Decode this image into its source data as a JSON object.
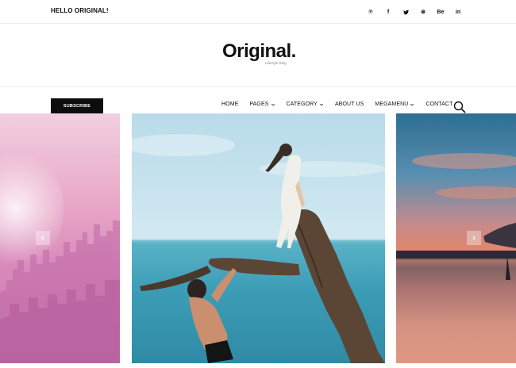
{
  "topbar": {
    "greeting": "HELLO ORIGINAL!",
    "socials": [
      {
        "icon": "pinterest-icon",
        "glyph": "℗"
      },
      {
        "icon": "facebook-icon",
        "glyph": "f"
      },
      {
        "icon": "twitter-icon",
        "glyph": "t"
      },
      {
        "icon": "dribbble-icon",
        "glyph": "⊛"
      },
      {
        "icon": "behance-icon",
        "glyph": "Be"
      },
      {
        "icon": "linkedin-icon",
        "glyph": "in"
      }
    ]
  },
  "brand": {
    "logo": "Original.",
    "tagline": "Lifestyle Blog"
  },
  "nav": {
    "subscribe_label": "SUBSCRIBE",
    "items": [
      {
        "label": "HOME",
        "dropdown": false
      },
      {
        "label": "PAGES",
        "dropdown": true
      },
      {
        "label": "CATEGORY",
        "dropdown": true
      },
      {
        "label": "ABOUT US",
        "dropdown": false
      },
      {
        "label": "MEGAMENU",
        "dropdown": true
      },
      {
        "label": "CONTACT",
        "dropdown": false
      }
    ],
    "search_icon": "search-icon"
  },
  "slider": {
    "slides": [
      "pink-city-skyline",
      "couple-on-tree-by-sea",
      "sunset-beach"
    ],
    "prev_icon": "chevron-left-icon",
    "next_icon": "chevron-right-icon"
  },
  "colors": {
    "text": "#111111",
    "button_bg": "#0d0d0d",
    "border": "#ececec"
  }
}
